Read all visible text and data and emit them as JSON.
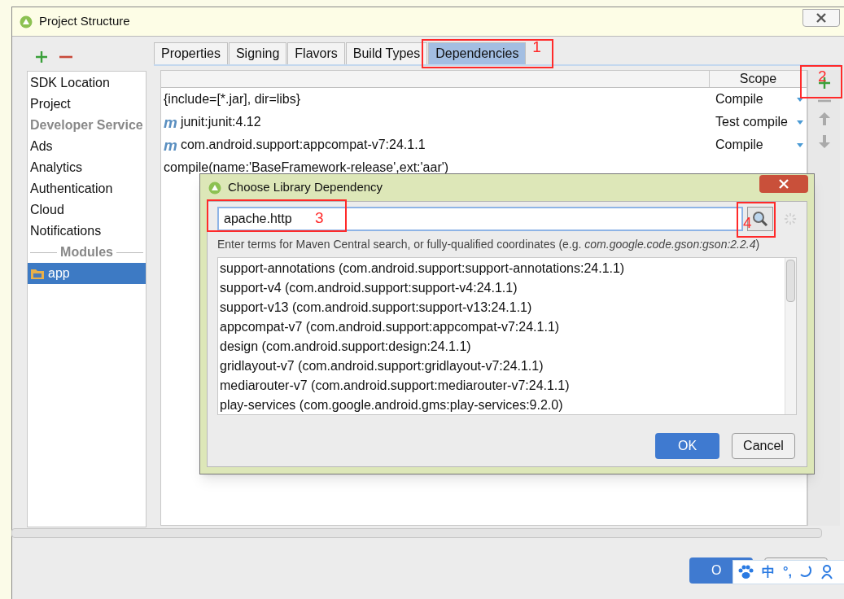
{
  "window": {
    "title": "Project Structure"
  },
  "sidebar": {
    "items": [
      {
        "label": "SDK Location",
        "kind": "item",
        "selected": false
      },
      {
        "label": "Project",
        "kind": "item",
        "selected": false
      },
      {
        "label": "Developer Service",
        "kind": "header",
        "selected": false
      },
      {
        "label": "Ads",
        "kind": "item",
        "selected": false
      },
      {
        "label": "Analytics",
        "kind": "item",
        "selected": false
      },
      {
        "label": "Authentication",
        "kind": "item",
        "selected": false
      },
      {
        "label": "Cloud",
        "kind": "item",
        "selected": false
      },
      {
        "label": "Notifications",
        "kind": "item",
        "selected": false
      },
      {
        "label": "Modules",
        "kind": "separator",
        "selected": false
      },
      {
        "label": "app",
        "kind": "module",
        "selected": true
      }
    ]
  },
  "tabs": [
    {
      "label": "Properties",
      "selected": false
    },
    {
      "label": "Signing",
      "selected": false
    },
    {
      "label": "Flavors",
      "selected": false
    },
    {
      "label": "Build Types",
      "selected": false
    },
    {
      "label": "Dependencies",
      "selected": true,
      "annotation": "1"
    }
  ],
  "table": {
    "columns": [
      "Scope"
    ],
    "add_annotation": "2",
    "rows": [
      {
        "badge": "",
        "name": "{include=[*.jar], dir=libs}",
        "scope": "Compile"
      },
      {
        "badge": "m",
        "name": "junit:junit:4.12",
        "scope": "Test compile"
      },
      {
        "badge": "m",
        "name": "com.android.support:appcompat-v7:24.1.1",
        "scope": "Compile"
      },
      {
        "badge": "",
        "name": "compile(name:'BaseFramework-release',ext:'aar')",
        "scope": ""
      }
    ]
  },
  "dialog": {
    "title": "Choose Library Dependency",
    "search": {
      "value": "apache.http",
      "annotation": "3"
    },
    "search_button": {
      "annotation": "4"
    },
    "hint": "Enter terms for Maven Central search, or fully-qualified coordinates (e.g. *com.google.code.gson:gson:2.2.4*)",
    "results": [
      "support-annotations (com.android.support:support-annotations:24.1.1)",
      "support-v4 (com.android.support:support-v4:24.1.1)",
      "support-v13 (com.android.support:support-v13:24.1.1)",
      "appcompat-v7 (com.android.support:appcompat-v7:24.1.1)",
      "design (com.android.support:design:24.1.1)",
      "gridlayout-v7 (com.android.support:gridlayout-v7:24.1.1)",
      "mediarouter-v7 (com.android.support:mediarouter-v7:24.1.1)",
      "play-services (com.google.android.gms:play-services:9.2.0)"
    ],
    "buttons": [
      "OK",
      "Cancel"
    ]
  },
  "footer": {
    "ok": "O"
  },
  "ime": {
    "mode": "中",
    "punct": "°,"
  }
}
